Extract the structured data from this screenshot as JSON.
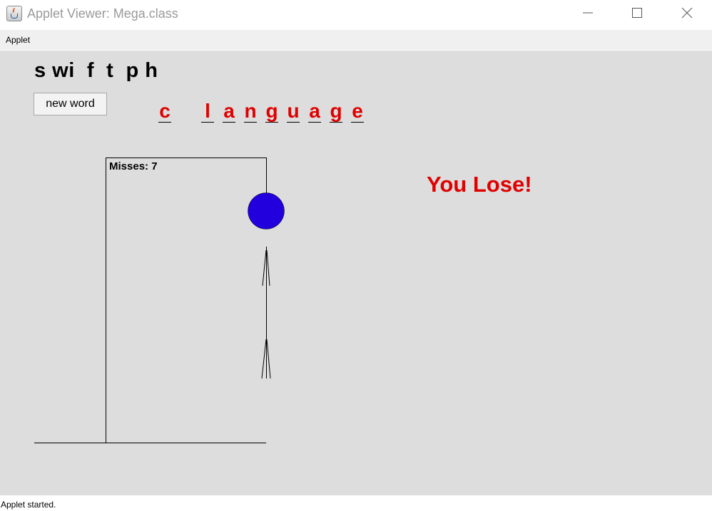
{
  "window": {
    "title": "Applet Viewer: Mega.class",
    "icon": "java-cup-icon"
  },
  "menubar": {
    "items": [
      "Applet"
    ]
  },
  "game": {
    "guessed_letters": "s wi  f  t  p h",
    "new_word_label": "new word",
    "word_letters": [
      "c",
      "",
      "l",
      "a",
      "n",
      "g",
      "u",
      "a",
      "g",
      "e"
    ],
    "misses_text": "Misses: 7",
    "result_text": "You Lose!",
    "head_color": "#2200dd",
    "result_color": "#e00000"
  },
  "status": {
    "text": "Applet started."
  }
}
